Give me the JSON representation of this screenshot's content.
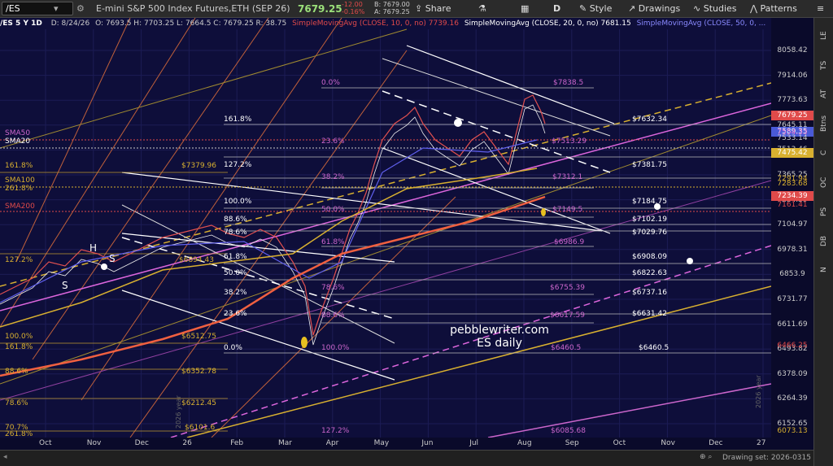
{
  "toolbar": {
    "symbol": "/ES",
    "description": "E-mini S&P 500 Index Futures,ETH (SEP 26)",
    "last_price": "7679.25",
    "change": "-12.00",
    "change_pct": "-0.16%",
    "bid": "B: 7679.00",
    "ask": "A: 7679.25",
    "share_label": "Share",
    "d_label": "D",
    "style_label": "Style",
    "drawings_label": "Drawings",
    "studies_label": "Studies",
    "patterns_label": "Patterns"
  },
  "info_line": {
    "symbol_period": "/ES 5 Y 1D",
    "date": "D: 8/24/26",
    "ohlc": "O: 7693.5  H: 7703.25  L: 7664.5  C: 7679.25  R: 38.75",
    "sma10": "SimpleMovingAvg (CLOSE, 10, 0, no)  7739.16",
    "sma20": "SimpleMovingAvg (CLOSE, 20, 0, no)  7681.15",
    "sma50": "SimpleMovingAvg (CLOSE, 50, 0, ..."
  },
  "right_tabs": [
    "LE",
    "TS",
    "AT",
    "Btns",
    "C",
    "OC",
    "PS",
    "DB",
    "N"
  ],
  "price_axis": [
    "8058.42",
    "7914.06",
    "7773.63",
    "7645.11",
    "7513.46",
    "7365.25",
    "7234.39",
    "7104.97",
    "6978.31",
    "6853.9",
    "6731.77",
    "6611.69",
    "6493.82",
    "6378.09",
    "6264.39",
    "6152.65"
  ],
  "price_tags": [
    {
      "text": "7679.25",
      "color": "#e04a4a"
    },
    {
      "text": "7589.35",
      "color": "#4a5ad8"
    },
    {
      "text": "7554.33",
      "color": "#cc66cc"
    },
    {
      "text": "7533.14",
      "color": "#cccccc"
    },
    {
      "text": "7475.42",
      "color": "#d8b030"
    },
    {
      "text": "7291.94",
      "color": "#d8b030"
    },
    {
      "text": "7283.68",
      "color": "#d8b030"
    },
    {
      "text": "7234.39",
      "color": "#e04a4a"
    },
    {
      "text": "7161.41",
      "color": "#e04a4a"
    },
    {
      "text": "6466.25",
      "color": "#e04a4a"
    },
    {
      "text": "6073.13",
      "color": "#d8b030"
    }
  ],
  "x_axis": [
    "Oct",
    "Nov",
    "Dec",
    "26",
    "Feb",
    "Mar",
    "Apr",
    "May",
    "Jun",
    "Jul",
    "Aug",
    "Sep",
    "Oct",
    "Nov",
    "Dec",
    "27"
  ],
  "fib_labels_upper": [
    {
      "t": "0.0%",
      "c": "#cc66cc"
    },
    {
      "t": "$7838.5",
      "c": "#cc66cc"
    },
    {
      "t": "161.8%",
      "c": "#ffffff"
    },
    {
      "t": "$7632.34",
      "c": "#ffffff"
    },
    {
      "t": "23.6%",
      "c": "#cc66cc"
    },
    {
      "t": "$7513.29",
      "c": "#cc66cc"
    },
    {
      "t": "127.2%",
      "c": "#ffffff"
    },
    {
      "t": "$7381.75",
      "c": "#ffffff"
    },
    {
      "t": "38.2%",
      "c": "#cc66cc"
    },
    {
      "t": "$7312.1",
      "c": "#cc66cc"
    },
    {
      "t": "100.0%",
      "c": "#ffffff"
    },
    {
      "t": "$7184.75",
      "c": "#ffffff"
    },
    {
      "t": "50.0%",
      "c": "#cc66cc"
    },
    {
      "t": "$7149.5",
      "c": "#cc66cc"
    },
    {
      "t": "88.6%",
      "c": "#ffffff"
    },
    {
      "t": "$7102.19",
      "c": "#ffffff"
    },
    {
      "t": "78.6%",
      "c": "#ffffff"
    },
    {
      "t": "$7029.76",
      "c": "#ffffff"
    },
    {
      "t": "61.8%",
      "c": "#cc66cc"
    },
    {
      "t": "$6986.9",
      "c": "#cc66cc"
    },
    {
      "t": "61.8%",
      "c": "#ffffff"
    },
    {
      "t": "$6908.09",
      "c": "#ffffff"
    },
    {
      "t": "50.0%",
      "c": "#ffffff"
    },
    {
      "t": "$6822.63",
      "c": "#ffffff"
    },
    {
      "t": "78.6%",
      "c": "#cc66cc"
    },
    {
      "t": "$6755.39",
      "c": "#cc66cc"
    },
    {
      "t": "38.2%",
      "c": "#ffffff"
    },
    {
      "t": "$6737.16",
      "c": "#ffffff"
    },
    {
      "t": "23.6%",
      "c": "#ffffff"
    },
    {
      "t": "88.6%",
      "c": "#cc66cc"
    },
    {
      "t": "$6617.59",
      "c": "#cc66cc"
    },
    {
      "t": "$6631.42",
      "c": "#ffffff"
    },
    {
      "t": "0.0%",
      "c": "#ffffff"
    },
    {
      "t": "100.0%",
      "c": "#cc66cc"
    },
    {
      "t": "$6460.5",
      "c": "#cc66cc"
    },
    {
      "t": "$6460.5",
      "c": "#ffffff"
    },
    {
      "t": "127.2%",
      "c": "#cc66cc"
    },
    {
      "t": "$6085.68",
      "c": "#cc66cc"
    }
  ],
  "fib_labels_left": [
    {
      "t": "161.8%",
      "c": "#d8b030"
    },
    {
      "t": "$7379.96",
      "c": "#d8b030"
    },
    {
      "t": "SMA100",
      "c": "#d8b030"
    },
    {
      "t": "261.8%",
      "c": "#d8b030"
    },
    {
      "t": "SMA200",
      "c": "#e04a4a"
    },
    {
      "t": "127.2%",
      "c": "#d8b030"
    },
    {
      "t": "$6894.43",
      "c": "#d8b030"
    },
    {
      "t": "100.0%",
      "c": "#d8b030"
    },
    {
      "t": "$6512.75",
      "c": "#d8b030"
    },
    {
      "t": "161.8%",
      "c": "#d8b030"
    },
    {
      "t": "88.6%",
      "c": "#d8b030"
    },
    {
      "t": "$6352.78",
      "c": "#d8b030"
    },
    {
      "t": "78.6%",
      "c": "#d8b030"
    },
    {
      "t": "$6212.45",
      "c": "#d8b030"
    },
    {
      "t": "70.7%",
      "c": "#d8b030"
    },
    {
      "t": "$6101.6",
      "c": "#d8b030"
    },
    {
      "t": "261.8%",
      "c": "#d8b030"
    },
    {
      "t": "SMA50",
      "c": "#cc66cc"
    },
    {
      "t": "SMA20",
      "c": "#ffffff"
    }
  ],
  "pattern_labels": [
    "H",
    "S",
    "S"
  ],
  "watermark": [
    "pebblewriter.com",
    "ES daily"
  ],
  "year_marker": "2026 year",
  "status_text": "Drawing set: 2026-0315"
}
